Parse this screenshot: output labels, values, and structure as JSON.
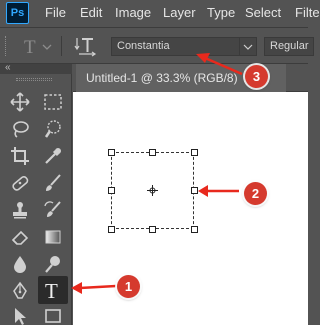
{
  "app": {
    "logo_text": "Ps"
  },
  "menu": [
    "File",
    "Edit",
    "Image",
    "Layer",
    "Type",
    "Select",
    "Filter"
  ],
  "options_bar": {
    "tool_glyph": "T",
    "orientation_icon": "text-orientation-icon",
    "font_family": "Constantia",
    "font_style": "Regular"
  },
  "toolbar": {
    "collapse_glyph": "«",
    "type_tool_glyph": "T"
  },
  "document": {
    "tab_title": "Untitled-1 @ 33.3% (RGB/8)"
  },
  "callouts": [
    "1",
    "2",
    "3"
  ],
  "colors": {
    "accent": "#d53a2e",
    "canvas": "#ffffff",
    "panel": "#535353",
    "active_tool": "#2b2b2b"
  }
}
